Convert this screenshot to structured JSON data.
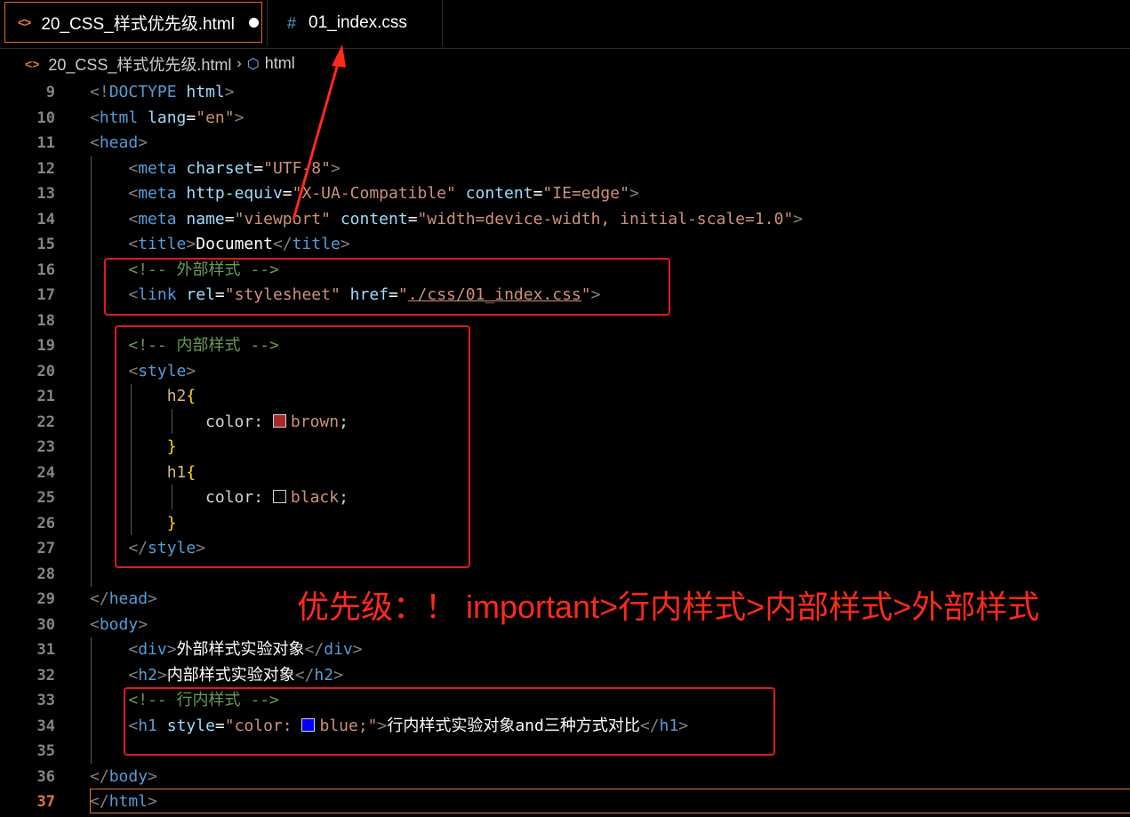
{
  "tabs": [
    {
      "label": "20_CSS_样式优先级.html",
      "icon": "html-file-icon",
      "active": true,
      "dirty": true
    },
    {
      "label": "01_index.css",
      "icon": "css-file-icon",
      "active": false
    }
  ],
  "breadcrumb": {
    "file": "20_CSS_样式优先级.html",
    "symbol": "html"
  },
  "lines": [
    {
      "n": "9",
      "tokens": [
        [
          "punc",
          "<!"
        ],
        [
          "tag",
          "DOCTYPE"
        ],
        [
          "text",
          " "
        ],
        [
          "attr",
          "html"
        ],
        [
          "punc",
          ">"
        ]
      ]
    },
    {
      "n": "10",
      "tokens": [
        [
          "punc",
          "<"
        ],
        [
          "tag",
          "html"
        ],
        [
          "text",
          " "
        ],
        [
          "attr",
          "lang"
        ],
        [
          "text",
          "="
        ],
        [
          "str",
          "\"en\""
        ],
        [
          "punc",
          ">"
        ]
      ]
    },
    {
      "n": "11",
      "tokens": [
        [
          "punc",
          "<"
        ],
        [
          "tag",
          "head"
        ],
        [
          "punc",
          ">"
        ]
      ]
    },
    {
      "n": "12",
      "tokens": [
        [
          "text",
          "    "
        ],
        [
          "punc",
          "<"
        ],
        [
          "tag",
          "meta"
        ],
        [
          "text",
          " "
        ],
        [
          "attr",
          "charset"
        ],
        [
          "text",
          "="
        ],
        [
          "str",
          "\"UTF-8\""
        ],
        [
          "punc",
          ">"
        ]
      ]
    },
    {
      "n": "13",
      "tokens": [
        [
          "text",
          "    "
        ],
        [
          "punc",
          "<"
        ],
        [
          "tag",
          "meta"
        ],
        [
          "text",
          " "
        ],
        [
          "attr",
          "http-equiv"
        ],
        [
          "text",
          "="
        ],
        [
          "str",
          "\"X-UA-Compatible\""
        ],
        [
          "text",
          " "
        ],
        [
          "attr",
          "content"
        ],
        [
          "text",
          "="
        ],
        [
          "str",
          "\"IE=edge\""
        ],
        [
          "punc",
          ">"
        ]
      ]
    },
    {
      "n": "14",
      "tokens": [
        [
          "text",
          "    "
        ],
        [
          "punc",
          "<"
        ],
        [
          "tag",
          "meta"
        ],
        [
          "text",
          " "
        ],
        [
          "attr",
          "name"
        ],
        [
          "text",
          "="
        ],
        [
          "str",
          "\"viewport\""
        ],
        [
          "text",
          " "
        ],
        [
          "attr",
          "content"
        ],
        [
          "text",
          "="
        ],
        [
          "str",
          "\"width=device-width, initial-scale=1.0\""
        ],
        [
          "punc",
          ">"
        ]
      ]
    },
    {
      "n": "15",
      "tokens": [
        [
          "text",
          "    "
        ],
        [
          "punc",
          "<"
        ],
        [
          "tag",
          "title"
        ],
        [
          "punc",
          ">"
        ],
        [
          "text",
          "Document"
        ],
        [
          "punc",
          "</"
        ],
        [
          "tag",
          "title"
        ],
        [
          "punc",
          ">"
        ]
      ]
    },
    {
      "n": "16",
      "tokens": [
        [
          "text",
          "    "
        ],
        [
          "com",
          "<!-- 外部样式 -->"
        ]
      ]
    },
    {
      "n": "17",
      "tokens": [
        [
          "text",
          "    "
        ],
        [
          "punc",
          "<"
        ],
        [
          "tag",
          "link"
        ],
        [
          "text",
          " "
        ],
        [
          "attr",
          "rel"
        ],
        [
          "text",
          "="
        ],
        [
          "str",
          "\"stylesheet\""
        ],
        [
          "text",
          " "
        ],
        [
          "attr",
          "href"
        ],
        [
          "text",
          "="
        ],
        [
          "str",
          "\""
        ],
        [
          "link",
          "./css/01_index.css"
        ],
        [
          "str",
          "\""
        ],
        [
          "punc",
          ">"
        ]
      ]
    },
    {
      "n": "18",
      "tokens": []
    },
    {
      "n": "19",
      "tokens": [
        [
          "text",
          "    "
        ],
        [
          "com",
          "<!-- 内部样式 -->"
        ]
      ]
    },
    {
      "n": "20",
      "tokens": [
        [
          "text",
          "    "
        ],
        [
          "punc",
          "<"
        ],
        [
          "tag",
          "style"
        ],
        [
          "punc",
          ">"
        ]
      ]
    },
    {
      "n": "21",
      "tokens": [
        [
          "text",
          "        "
        ],
        [
          "sel",
          "h2"
        ],
        [
          "brace",
          "{"
        ]
      ]
    },
    {
      "n": "22",
      "tokens": [
        [
          "text",
          "            "
        ],
        [
          "prop",
          "color: "
        ],
        [
          "swatch",
          "#a52a2a"
        ],
        [
          "val",
          "brown"
        ],
        [
          "prop",
          ";"
        ]
      ]
    },
    {
      "n": "23",
      "tokens": [
        [
          "text",
          "        "
        ],
        [
          "brace",
          "}"
        ]
      ]
    },
    {
      "n": "24",
      "tokens": [
        [
          "text",
          "        "
        ],
        [
          "sel",
          "h1"
        ],
        [
          "brace",
          "{"
        ]
      ]
    },
    {
      "n": "25",
      "tokens": [
        [
          "text",
          "            "
        ],
        [
          "prop",
          "color: "
        ],
        [
          "swatch",
          "#000000"
        ],
        [
          "val",
          "black"
        ],
        [
          "prop",
          ";"
        ]
      ]
    },
    {
      "n": "26",
      "tokens": [
        [
          "text",
          "        "
        ],
        [
          "brace",
          "}"
        ]
      ]
    },
    {
      "n": "27",
      "tokens": [
        [
          "text",
          "    "
        ],
        [
          "punc",
          "</"
        ],
        [
          "tag",
          "style"
        ],
        [
          "punc",
          ">"
        ]
      ]
    },
    {
      "n": "28",
      "tokens": []
    },
    {
      "n": "29",
      "tokens": [
        [
          "punc",
          "</"
        ],
        [
          "tag",
          "head"
        ],
        [
          "punc",
          ">"
        ]
      ]
    },
    {
      "n": "30",
      "tokens": [
        [
          "punc",
          "<"
        ],
        [
          "tag",
          "body"
        ],
        [
          "punc",
          ">"
        ]
      ]
    },
    {
      "n": "31",
      "tokens": [
        [
          "text",
          "    "
        ],
        [
          "punc",
          "<"
        ],
        [
          "tag",
          "div"
        ],
        [
          "punc",
          ">"
        ],
        [
          "text",
          "外部样式实验对象"
        ],
        [
          "punc",
          "</"
        ],
        [
          "tag",
          "div"
        ],
        [
          "punc",
          ">"
        ]
      ]
    },
    {
      "n": "32",
      "tokens": [
        [
          "text",
          "    "
        ],
        [
          "punc",
          "<"
        ],
        [
          "tag",
          "h2"
        ],
        [
          "punc",
          ">"
        ],
        [
          "text",
          "内部样式实验对象"
        ],
        [
          "punc",
          "</"
        ],
        [
          "tag",
          "h2"
        ],
        [
          "punc",
          ">"
        ]
      ]
    },
    {
      "n": "33",
      "tokens": [
        [
          "text",
          "    "
        ],
        [
          "com",
          "<!-- 行内样式 -->"
        ]
      ]
    },
    {
      "n": "34",
      "tokens": [
        [
          "text",
          "    "
        ],
        [
          "punc",
          "<"
        ],
        [
          "tag",
          "h1"
        ],
        [
          "text",
          " "
        ],
        [
          "attr",
          "style"
        ],
        [
          "text",
          "="
        ],
        [
          "str",
          "\"color: "
        ],
        [
          "swatch",
          "#0000ff"
        ],
        [
          "str",
          "blue;\""
        ],
        [
          "punc",
          ">"
        ],
        [
          "text",
          "行内样式实验对象and三种方式对比"
        ],
        [
          "punc",
          "</"
        ],
        [
          "tag",
          "h1"
        ],
        [
          "punc",
          ">"
        ]
      ]
    },
    {
      "n": "35",
      "tokens": []
    },
    {
      "n": "36",
      "tokens": [
        [
          "punc",
          "</"
        ],
        [
          "tag",
          "body"
        ],
        [
          "punc",
          ">"
        ]
      ]
    },
    {
      "n": "37",
      "tokens": [
        [
          "punc",
          "</"
        ],
        [
          "tag",
          "html"
        ],
        [
          "punc",
          ">"
        ]
      ],
      "current": true
    }
  ],
  "annotation": "优先级：！ important>行内样式>内部样式>外部样式",
  "colors": {
    "accent": "#e37933",
    "annotation": "#ff2a1a",
    "background": "#000000"
  }
}
